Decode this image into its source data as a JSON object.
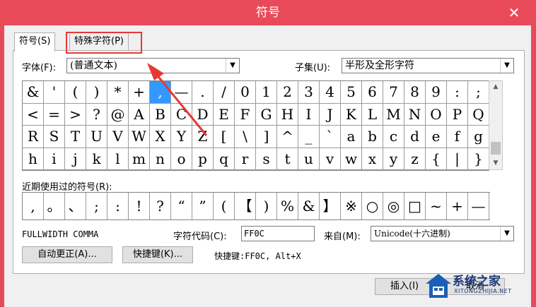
{
  "window": {
    "title": "符号",
    "close": "✕"
  },
  "tabs": [
    {
      "label": "符号(S)"
    },
    {
      "label": "特殊字符(P)"
    }
  ],
  "font": {
    "label": "字体(F):",
    "value": "(普通文本)"
  },
  "subset": {
    "label": "子集(U):",
    "value": "半形及全形字符"
  },
  "grid": [
    [
      "&",
      "'",
      "(",
      ")",
      "*",
      "+",
      ",",
      "—",
      ".",
      "/",
      "0",
      "1",
      "2",
      "3",
      "4",
      "5",
      "6",
      "7",
      "8",
      "9",
      ":",
      ";"
    ],
    [
      "<",
      "=",
      ">",
      "?",
      "@",
      "A",
      "B",
      "C",
      "D",
      "E",
      "F",
      "G",
      "H",
      "I",
      "J",
      "K",
      "L",
      "M",
      "N",
      "O",
      "P",
      "Q"
    ],
    [
      "R",
      "S",
      "T",
      "U",
      "V",
      "W",
      "X",
      "Y",
      "Z",
      "[",
      "\\",
      "]",
      "^",
      "_",
      "`",
      "a",
      "b",
      "c",
      "d",
      "e",
      "f",
      "g"
    ],
    [
      "h",
      "i",
      "j",
      "k",
      "l",
      "m",
      "n",
      "o",
      "p",
      "q",
      "r",
      "s",
      "t",
      "u",
      "v",
      "w",
      "x",
      "y",
      "z",
      "{",
      "|",
      "}"
    ]
  ],
  "selected": ",",
  "recent": {
    "label": "近期使用过的符号(R):",
    "symbols": [
      ",",
      "。",
      "、",
      ";",
      ":",
      "!",
      "?",
      "“",
      "”",
      "(",
      "【",
      ")",
      "%",
      "&",
      "】",
      "※",
      "○",
      "◎",
      "□",
      "~",
      "+",
      "—"
    ]
  },
  "char_name": "FULLWIDTH COMMA",
  "char_code": {
    "label": "字符代码(C):",
    "value": "FF0C"
  },
  "from": {
    "label": "来自(M):",
    "value": "Unicode(十六进制)"
  },
  "buttons": {
    "autocorrect": "自动更正(A)...",
    "shortcut_key": "快捷键(K)...",
    "insert": "插入(I)",
    "cancel": "取消"
  },
  "shortcut_text": "快捷键:FF0C, Alt+X",
  "watermark": {
    "line1": "系统之家",
    "line2": "XITONGZHIJIA.NET"
  },
  "colors": {
    "titlebar": "#e94a5a",
    "highlight": "#e53935",
    "selection": "#3399ff"
  }
}
